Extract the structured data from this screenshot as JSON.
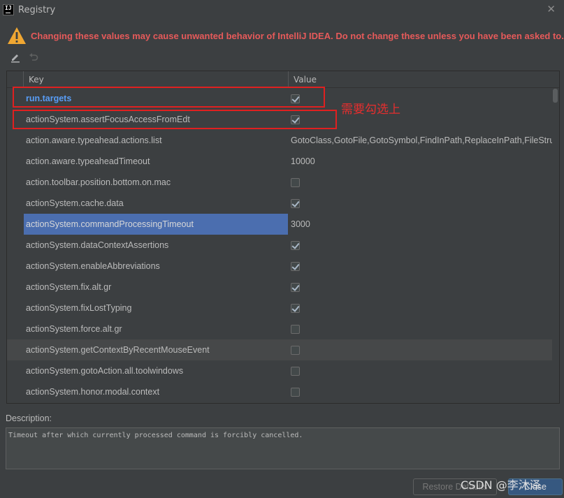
{
  "window": {
    "title": "Registry",
    "app_icon_text": "IJ"
  },
  "warning": {
    "text": "Changing these values may cause unwanted behavior of IntelliJ IDEA. Do not change these unless you have been asked to."
  },
  "table": {
    "columns": {
      "key": "Key",
      "value": "Value"
    },
    "rows": [
      {
        "key": "run.targets",
        "type": "checkbox",
        "checked": true,
        "changed": true
      },
      {
        "key": "actionSystem.assertFocusAccessFromEdt",
        "type": "checkbox",
        "checked": true
      },
      {
        "key": "action.aware.typeahead.actions.list",
        "type": "text",
        "value": "GotoClass,GotoFile,GotoSymbol,FindInPath,ReplaceInPath,FileStru"
      },
      {
        "key": "action.aware.typeaheadTimeout",
        "type": "text",
        "value": "10000"
      },
      {
        "key": "action.toolbar.position.bottom.on.mac",
        "type": "checkbox",
        "checked": false
      },
      {
        "key": "actionSystem.cache.data",
        "type": "checkbox",
        "checked": true
      },
      {
        "key": "actionSystem.commandProcessingTimeout",
        "type": "text",
        "value": "3000",
        "selected": true
      },
      {
        "key": "actionSystem.dataContextAssertions",
        "type": "checkbox",
        "checked": true
      },
      {
        "key": "actionSystem.enableAbbreviations",
        "type": "checkbox",
        "checked": true
      },
      {
        "key": "actionSystem.fix.alt.gr",
        "type": "checkbox",
        "checked": true
      },
      {
        "key": "actionSystem.fixLostTyping",
        "type": "checkbox",
        "checked": true
      },
      {
        "key": "actionSystem.force.alt.gr",
        "type": "checkbox",
        "checked": false
      },
      {
        "key": "actionSystem.getContextByRecentMouseEvent",
        "type": "checkbox",
        "checked": false,
        "hover": true
      },
      {
        "key": "actionSystem.gotoAction.all.toolwindows",
        "type": "checkbox",
        "checked": false
      },
      {
        "key": "actionSystem.honor.modal.context",
        "type": "checkbox",
        "checked": false
      }
    ]
  },
  "annotation": {
    "text": "需要勾选上",
    "color": "#e62e2e"
  },
  "description": {
    "label": "Description:",
    "text": "Timeout after which currently processed command is forcibly cancelled."
  },
  "buttons": {
    "restore": "Restore Defaults",
    "close": "Close"
  },
  "watermark": "CSDN @李沐泽",
  "icons": [
    "app-icon",
    "warning-icon",
    "edit-icon",
    "revert-icon",
    "close-icon",
    "checkbox"
  ],
  "colors": {
    "warning": "#e65a5a",
    "changed_key": "#589df6",
    "selection": "#4b6eaf",
    "highlight_box": "#e02020"
  }
}
